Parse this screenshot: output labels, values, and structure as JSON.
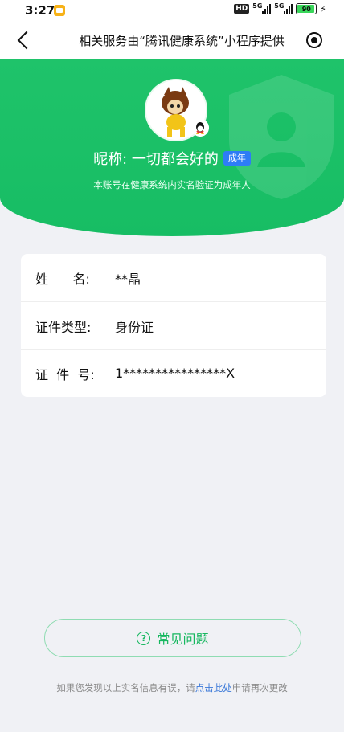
{
  "status_bar": {
    "time": "3:27",
    "hd_label": "HD",
    "signal1_label": "5G",
    "signal2_label": "5G",
    "battery": "90"
  },
  "nav": {
    "title": "相关服务由“腾讯健康系统”小程序提供"
  },
  "header": {
    "nickname": "昵称: 一切都会好的",
    "adult_badge": "成年",
    "verify_note": "本账号在健康系统内实名验证为成年人"
  },
  "info": {
    "rows": [
      {
        "label": "姓      名:",
        "value": "**晶"
      },
      {
        "label": "证件类型:",
        "value": "身份证"
      },
      {
        "label": "证  件  号:",
        "value": "1****************X"
      }
    ]
  },
  "faq": {
    "label": "常见问题",
    "icon_char": "?"
  },
  "footer": {
    "before": "如果您发现以上实名信息有误，请",
    "link": "点击此处",
    "after": "申请再次更改"
  },
  "colors": {
    "header_green": "#1fc36a",
    "accent_green": "#16b75f",
    "badge_blue": "#2e7cf6",
    "link_blue": "#3a78d8"
  }
}
